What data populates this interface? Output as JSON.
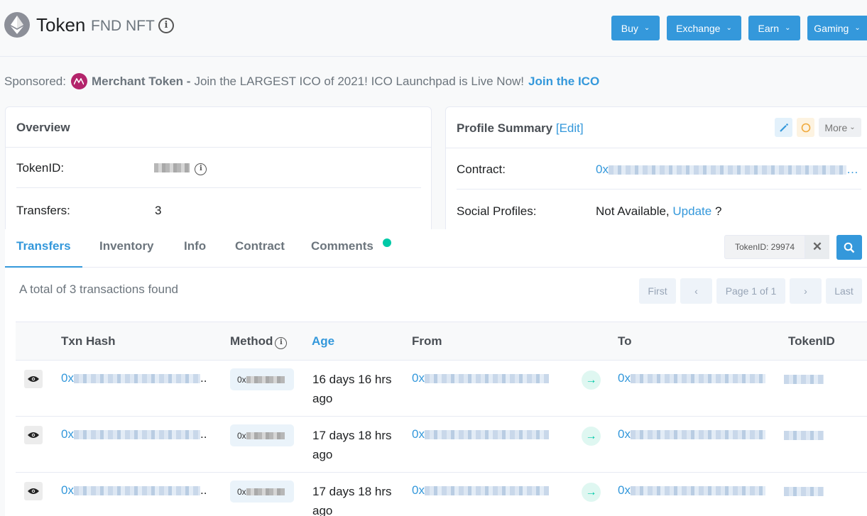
{
  "header": {
    "title": "Token",
    "subtitle": "FND NFT",
    "buttons": [
      {
        "label": "Buy"
      },
      {
        "label": "Exchange"
      },
      {
        "label": "Earn"
      },
      {
        "label": "Gaming"
      }
    ]
  },
  "sponsored": {
    "prefix": "Sponsored:",
    "name": "Merchant Token -",
    "text": "Join the LARGEST ICO of 2021! ICO Launchpad is Live Now!",
    "link": "Join the ICO"
  },
  "overview": {
    "title": "Overview",
    "token_id_label": "TokenID:",
    "transfers_label": "Transfers:",
    "transfers_value": "3"
  },
  "profile": {
    "title": "Profile Summary",
    "edit_link": "[Edit]",
    "more_label": "More",
    "contract_label": "Contract:",
    "contract_prefix": "0x",
    "social_label": "Social Profiles:",
    "social_value": "Not Available,",
    "social_update": "Update",
    "social_q": "?"
  },
  "tabs": [
    {
      "label": "Transfers"
    },
    {
      "label": "Inventory"
    },
    {
      "label": "Info"
    },
    {
      "label": "Contract"
    },
    {
      "label": "Comments"
    }
  ],
  "search": {
    "value": "TokenID: 29974"
  },
  "summary": "A total of 3 transactions found",
  "pagination": {
    "first": "First",
    "page": "Page 1 of 1",
    "last": "Last"
  },
  "table": {
    "headers": {
      "txn_hash": "Txn Hash",
      "method": "Method",
      "age": "Age",
      "from": "From",
      "to": "To",
      "token_id": "TokenID"
    },
    "rows": [
      {
        "hash_prefix": "0x",
        "method_prefix": "0x",
        "age_line1": "16 days 16 hrs",
        "age_line2": "ago",
        "from_prefix": "0x",
        "to_prefix": "0x"
      },
      {
        "hash_prefix": "0x",
        "method_prefix": "0x",
        "age_line1": "17 days 18 hrs",
        "age_line2": "ago",
        "from_prefix": "0x",
        "to_prefix": "0x"
      },
      {
        "hash_prefix": "0x",
        "method_prefix": "0x",
        "age_line1": "17 days 18 hrs",
        "age_line2": "ago",
        "from_prefix": "0x",
        "to_prefix": "0x"
      }
    ]
  },
  "colors": {
    "primary": "#3498db",
    "success": "#00c9a7",
    "sponsor": "#b3246b"
  }
}
